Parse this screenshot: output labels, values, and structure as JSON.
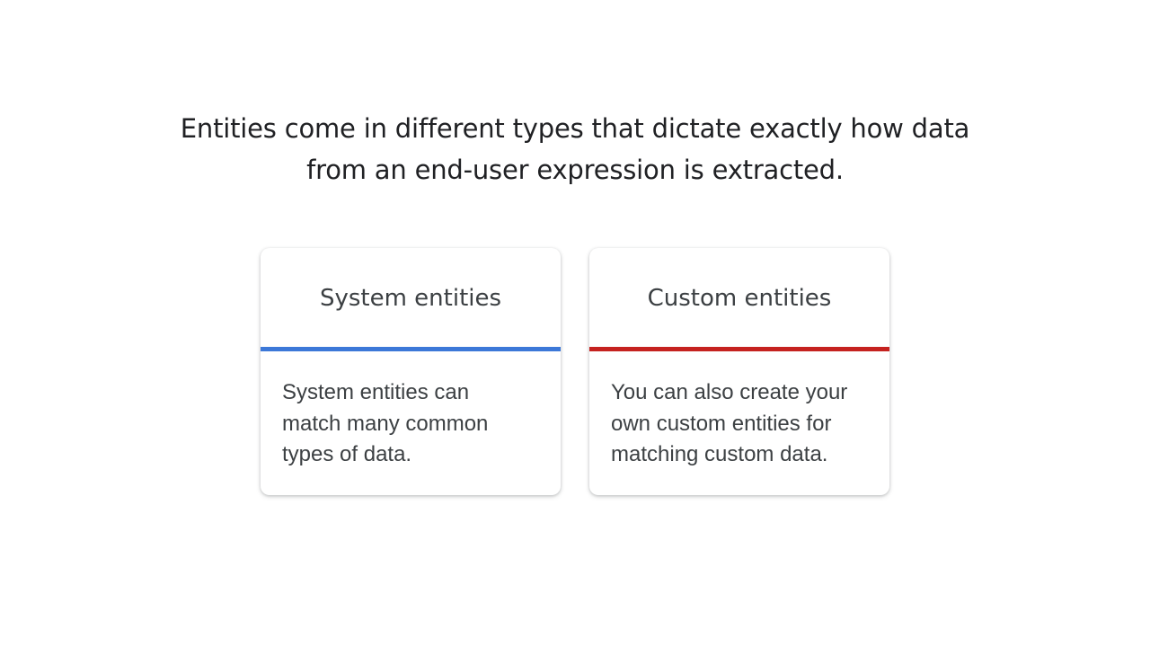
{
  "headline": {
    "line1": "Entities come in different types that dictate exactly how data",
    "line2": "from an end-user expression is extracted."
  },
  "cards": [
    {
      "title": "System entities",
      "accent_color": "#3c78d8",
      "body_lines": [
        "System entities can",
        "match many common",
        "types of data."
      ]
    },
    {
      "title": "Custom entities",
      "accent_color": "#c5221f",
      "body_lines": [
        "You can also create your",
        "own custom entities for",
        "matching custom data."
      ]
    }
  ]
}
